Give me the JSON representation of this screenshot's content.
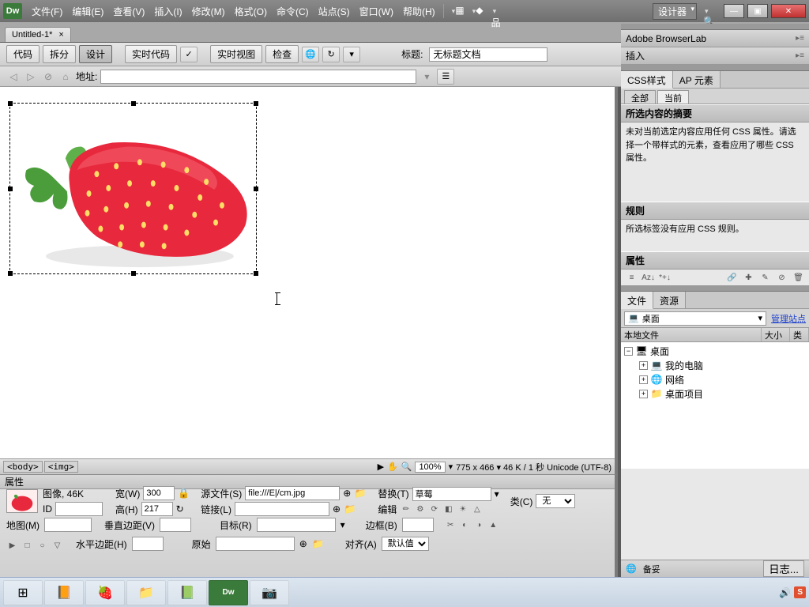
{
  "menubar": {
    "items": [
      "文件(F)",
      "编辑(E)",
      "查看(V)",
      "插入(I)",
      "修改(M)",
      "格式(O)",
      "命令(C)",
      "站点(S)",
      "窗口(W)",
      "帮助(H)"
    ],
    "workspace": "设计器"
  },
  "doc_tab": {
    "title": "Untitled-1*",
    "close": "×"
  },
  "toolbar1": {
    "code": "代码",
    "split": "拆分",
    "design": "设计",
    "live_code": "实时代码",
    "live_view": "实时视图",
    "inspect": "检查",
    "title_label": "标题:",
    "title_value": "无标题文档"
  },
  "toolbar2": {
    "address_label": "地址:"
  },
  "tag_selector": {
    "tags": [
      "<body>",
      "<img>"
    ],
    "zoom": "100%",
    "status": "775 x 466 ▾ 46 K / 1 秒 Unicode (UTF-8)"
  },
  "properties": {
    "title": "属性",
    "image_label": "图像, 46K",
    "id_label": "ID",
    "width_label": "宽(W)",
    "width_value": "300",
    "height_label": "高(H)",
    "height_value": "217",
    "src_label": "源文件(S)",
    "src_value": "file:///E|/cm.jpg",
    "link_label": "链接(L)",
    "alt_label": "替换(T)",
    "alt_value": "草莓",
    "edit_label": "编辑",
    "class_label": "类(C)",
    "class_value": "无",
    "map_label": "地图(M)",
    "vspace_label": "垂直边距(V)",
    "hspace_label": "水平边距(H)",
    "target_label": "目标(R)",
    "original_label": "原始",
    "border_label": "边框(B)",
    "align_label": "对齐(A)",
    "align_value": "默认值"
  },
  "panels": {
    "browserlab": "Adobe BrowserLab",
    "insert": "插入",
    "css_tab": "CSS样式",
    "ap_tab": "AP 元素",
    "all": "全部",
    "current": "当前",
    "summary_h": "所选内容的摘要",
    "summary_text": "未对当前选定内容应用任何 CSS 属性。请选择一个带样式的元素，查看应用了哪些 CSS 属性。",
    "rules_h": "规则",
    "rules_text": "所选标签没有应用 CSS 规则。",
    "props_h": "属性",
    "files_tab": "文件",
    "assets_tab": "资源",
    "desktop": "桌面",
    "manage": "管理站点",
    "col_local": "本地文件",
    "col_size": "大小",
    "col_type": "类",
    "tree": {
      "root": "桌面",
      "items": [
        "我的电脑",
        "网络",
        "桌面项目"
      ]
    },
    "ready": "备妥",
    "log": "日志..."
  }
}
